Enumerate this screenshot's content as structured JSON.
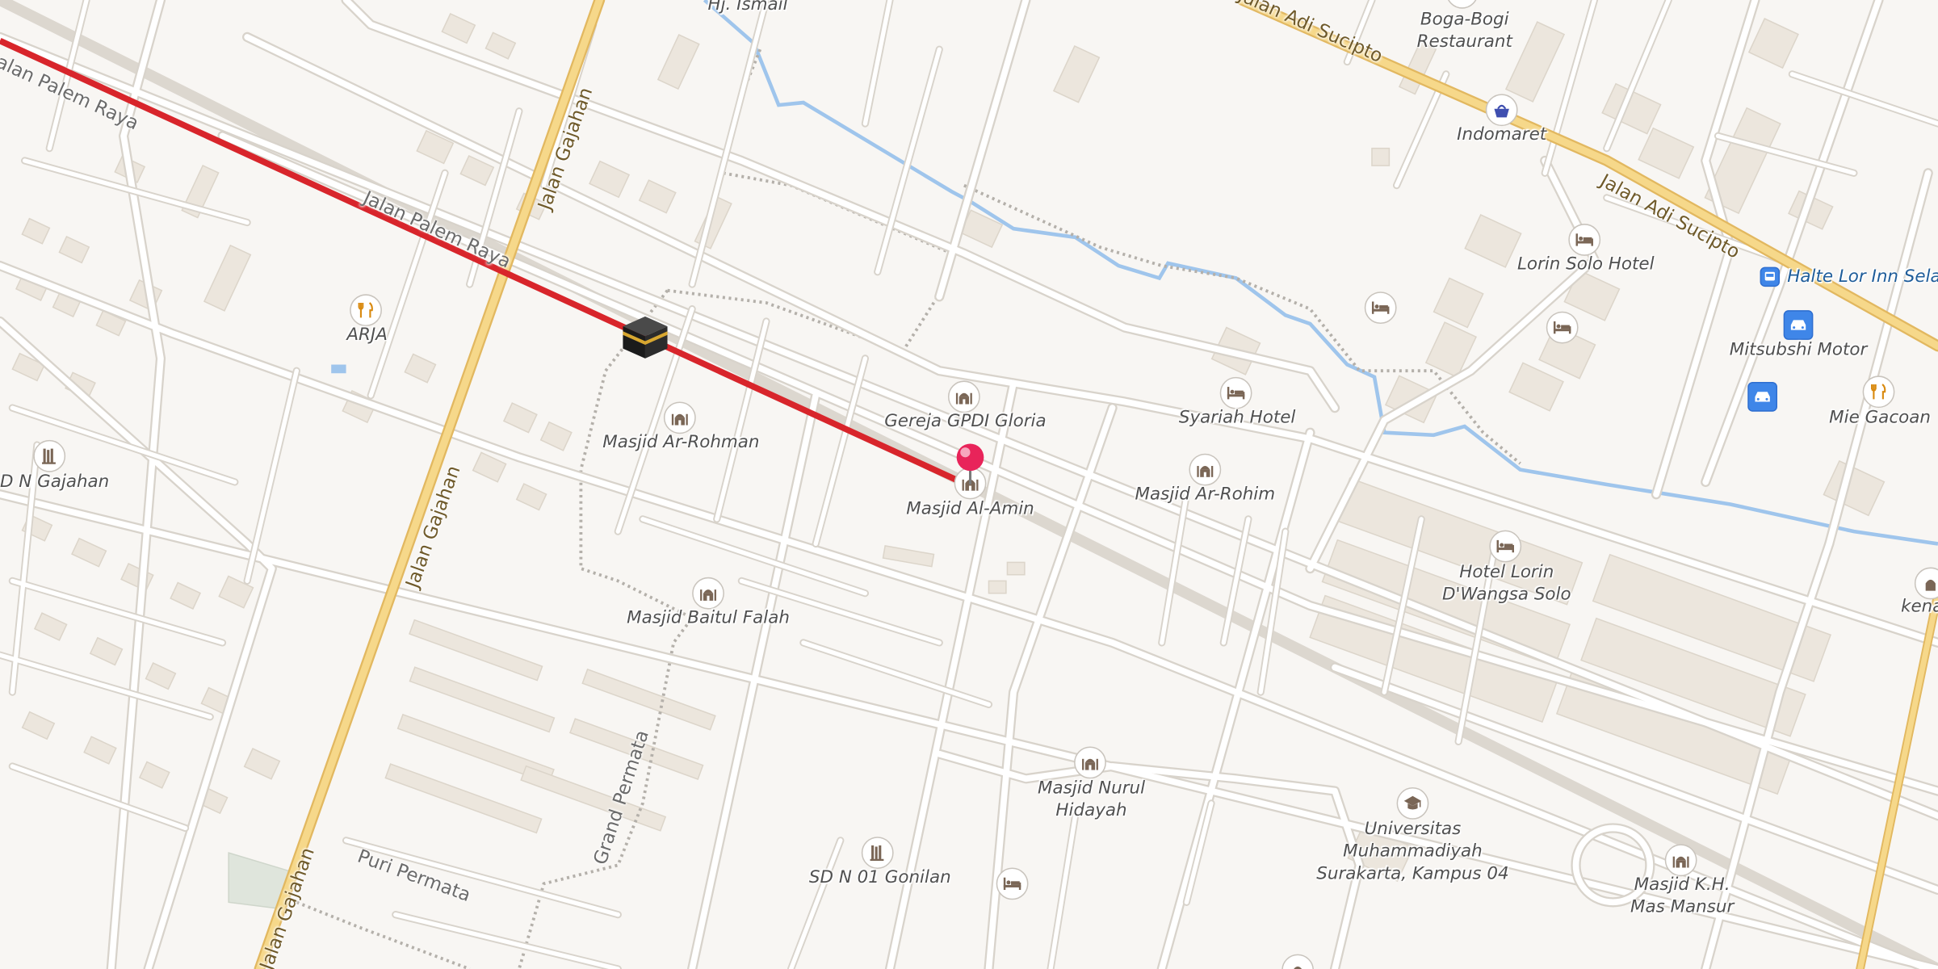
{
  "colors": {
    "background": "#f8f6f3",
    "road_minor": "#ffffff",
    "road_casing": "#dcd7cf",
    "road_major": "#f6d88a",
    "road_major_casing": "#e2b860",
    "building": "#ece6dd",
    "water": "#9fc5ec",
    "path": "#b4b0aa",
    "qibla_line": "#d8252b",
    "pin": "#e8245a",
    "poi_icon": "#7a6656",
    "transport_icon": "#3f86e8"
  },
  "streets": {
    "palem_raya_west": "alan Palem Raya",
    "palem_raya": "Jalan Palem Raya",
    "gajahan_north": "Jalan Gajahan",
    "gajahan_mid": "Jalan Gajahan",
    "gajahan_south": "Jalan Gajahan",
    "adi_sucipto_west": "Jalan Adi Sucipto",
    "adi_sucipto_east": "Jalan Adi Sucipto",
    "grand_permata": "Grand Permata",
    "puri_permata": "Puri Permata"
  },
  "places": {
    "hj_ismail": "Hj. Ismail",
    "boga_bogi": "Boga-Bogi\nRestaurant",
    "indomaret": "Indomaret",
    "lorin_solo_hotel": "Lorin Solo Hotel",
    "halte": "Halte Lor Inn Selat",
    "mitsubishi": "Mitsubshi Motor",
    "mie_gacoan": "Mie Gacoan",
    "arja": "ARJA",
    "sd_n_gajahan": "D N Gajahan",
    "masjid_ar_rohman": "Masjid Ar-Rohman",
    "gereja_gpdi": "Gereja GPDI Gloria",
    "syariah_hotel": "Syariah Hotel",
    "masjid_al_amin": "Masjid Al-Amin",
    "masjid_ar_rohim": "Masjid Ar-Rohim",
    "hotel_lorin_dwangsa": "Hotel Lorin\nD'Wangsa Solo",
    "kena": "kena",
    "masjid_baitul_falah": "Masjid Baitul Falah",
    "masjid_nurul_hidayah": "Masjid Nurul\nHidayah",
    "universitas_muhammadiyah": "Universitas\nMuhammadiyah\nSurakarta, Kampus 04",
    "sd_n_01_gonilan": "SD N 01 Gonilan",
    "masjid_kh_mas_mansur": "Masjid K.H.\nMas Mansur"
  },
  "icons": {
    "kaaba": "kaaba-icon",
    "pin": "location-pin-icon",
    "mosque": "mosque-icon",
    "church": "church-icon",
    "hotel": "bed-icon",
    "restaurant": "fork-knife-icon",
    "shop": "shopping-basket-icon",
    "school": "school-icon",
    "university": "graduation-cap-icon",
    "bus": "bus-stop-icon",
    "car": "car-dealer-icon"
  }
}
